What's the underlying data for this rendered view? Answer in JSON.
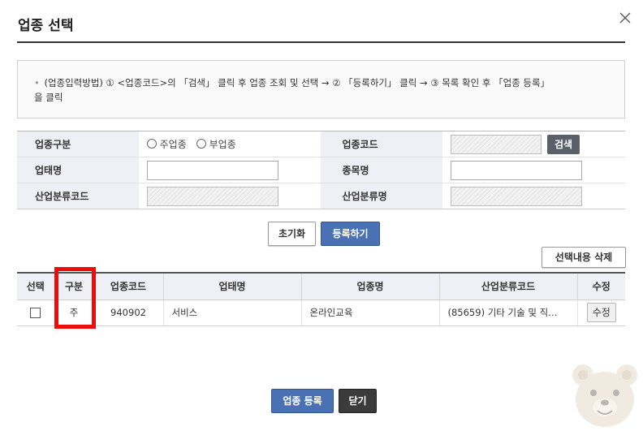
{
  "dialog": {
    "title": "업종 선택"
  },
  "info": {
    "bullet": "•",
    "text_line1": "(업종입력방법) ① <업종코드>의 「검색」 클릭 후 업종 조회 및 선택 → ② 「등록하기」 클릭 → ③ 목록 확인 후 「업종 등록」",
    "text_line2": "을 클릭"
  },
  "form": {
    "category_label": "업종구분",
    "radio_main": "주업종",
    "radio_sub": "부업종",
    "code_label": "업종코드",
    "code_value": "",
    "search_button": "검색",
    "business_type_label": "업태명",
    "business_type_value": "",
    "item_label": "종목명",
    "item_value": "",
    "industry_code_label": "산업분류코드",
    "industry_code_value": "",
    "industry_name_label": "산업분류명",
    "industry_name_value": ""
  },
  "actions": {
    "reset": "초기화",
    "register": "등록하기",
    "delete_selected": "선택내용 삭제"
  },
  "list": {
    "headers": [
      "선택",
      "구분",
      "업종코드",
      "업태명",
      "업종명",
      "산업분류코드",
      "수정"
    ],
    "rows": [
      {
        "division": "주",
        "code": "940902",
        "business_type": "서비스",
        "business_name": "온라인교육",
        "industry_code": "(85659) 기타 기술 및 직…",
        "edit": "수정"
      }
    ]
  },
  "footer": {
    "register_button": "업종 등록",
    "close_button": "닫기"
  },
  "colors": {
    "primary": "#4a71b3",
    "dark_button": "#3b3b3b",
    "search_button": "#5a6069",
    "highlight": "#ee0b0b",
    "division_text": "#d32d1f",
    "label_bg": "#eef0f5"
  }
}
